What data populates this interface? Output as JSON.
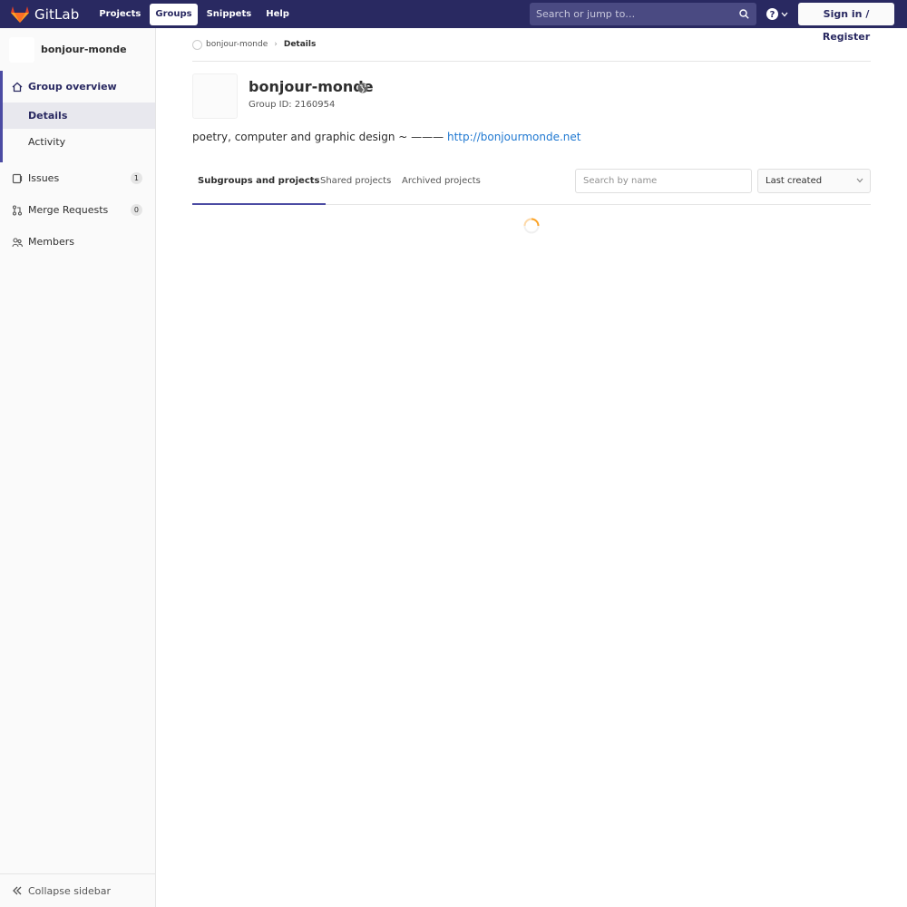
{
  "navbar": {
    "brand": "GitLab",
    "links": [
      "Projects",
      "Groups",
      "Snippets",
      "Help"
    ],
    "search_placeholder": "Search or jump to…",
    "signin": "Sign in / Register"
  },
  "sidebar": {
    "group_name": "bonjour-monde",
    "overview": "Group overview",
    "sub_items": [
      "Details",
      "Activity"
    ],
    "items": [
      {
        "label": "Issues",
        "badge": "1"
      },
      {
        "label": "Merge Requests",
        "badge": "0"
      },
      {
        "label": "Members"
      }
    ],
    "collapse": "Collapse sidebar"
  },
  "breadcrumb": {
    "group": "bonjour-monde",
    "current": "Details"
  },
  "group": {
    "name": "bonjour-monde",
    "id_text": "Group ID: 2160954",
    "description": "poetry, computer and graphic design ~ ———",
    "link": "http://bonjourmonde.net"
  },
  "tabs": [
    "Subgroups and projects",
    "Shared projects",
    "Archived projects"
  ],
  "filter": {
    "placeholder": "Search by name",
    "sort": "Last created"
  },
  "colors": {
    "navbar": "#292961",
    "accent": "#4b4ba3",
    "link": "#1f78d1",
    "spinner": "#fca326"
  }
}
